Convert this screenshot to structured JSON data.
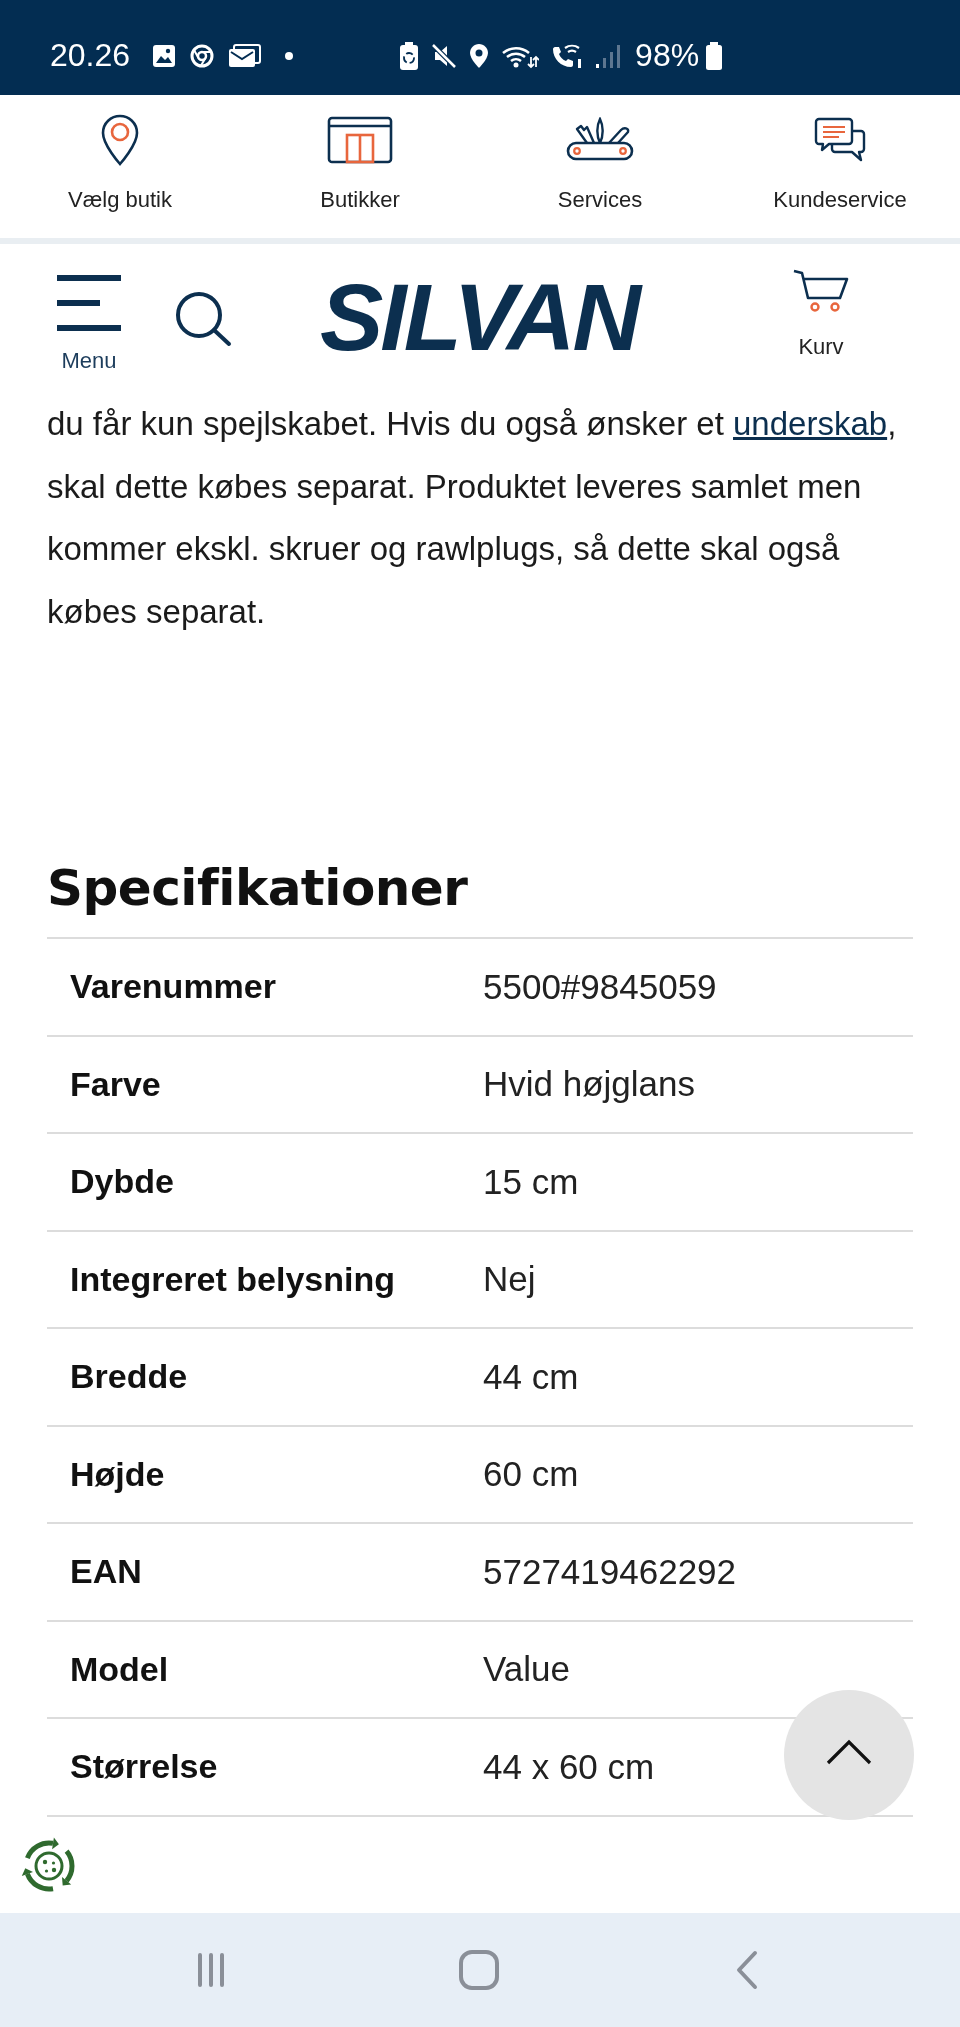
{
  "status_bar": {
    "time": "20.26",
    "battery": "98%"
  },
  "top_nav": [
    {
      "label": "Vælg butik"
    },
    {
      "label": "Butikker"
    },
    {
      "label": "Services"
    },
    {
      "label": "Kundeservice"
    }
  ],
  "header": {
    "menu_label": "Menu",
    "logo": "SILVAN",
    "cart_label": "Kurv"
  },
  "description": {
    "before": "du får kun spejlskabet. Hvis du også ønsker et ",
    "link": "underskab",
    "after": ", skal dette købes separat. Produktet leveres samlet men kommer ekskl. skruer og rawlplugs, så dette skal også købes separat."
  },
  "specifications": {
    "title": "Specifikationer",
    "rows": [
      {
        "label": "Varenummer",
        "value": "5500#9845059"
      },
      {
        "label": "Farve",
        "value": "Hvid højglans"
      },
      {
        "label": "Dybde",
        "value": "15 cm"
      },
      {
        "label": "Integreret belysning",
        "value": "Nej"
      },
      {
        "label": "Bredde",
        "value": "44 cm"
      },
      {
        "label": "Højde",
        "value": "60 cm"
      },
      {
        "label": "EAN",
        "value": "5727419462292"
      },
      {
        "label": "Model",
        "value": "Value"
      },
      {
        "label": "Størrelse",
        "value": "44 x 60 cm"
      }
    ]
  }
}
